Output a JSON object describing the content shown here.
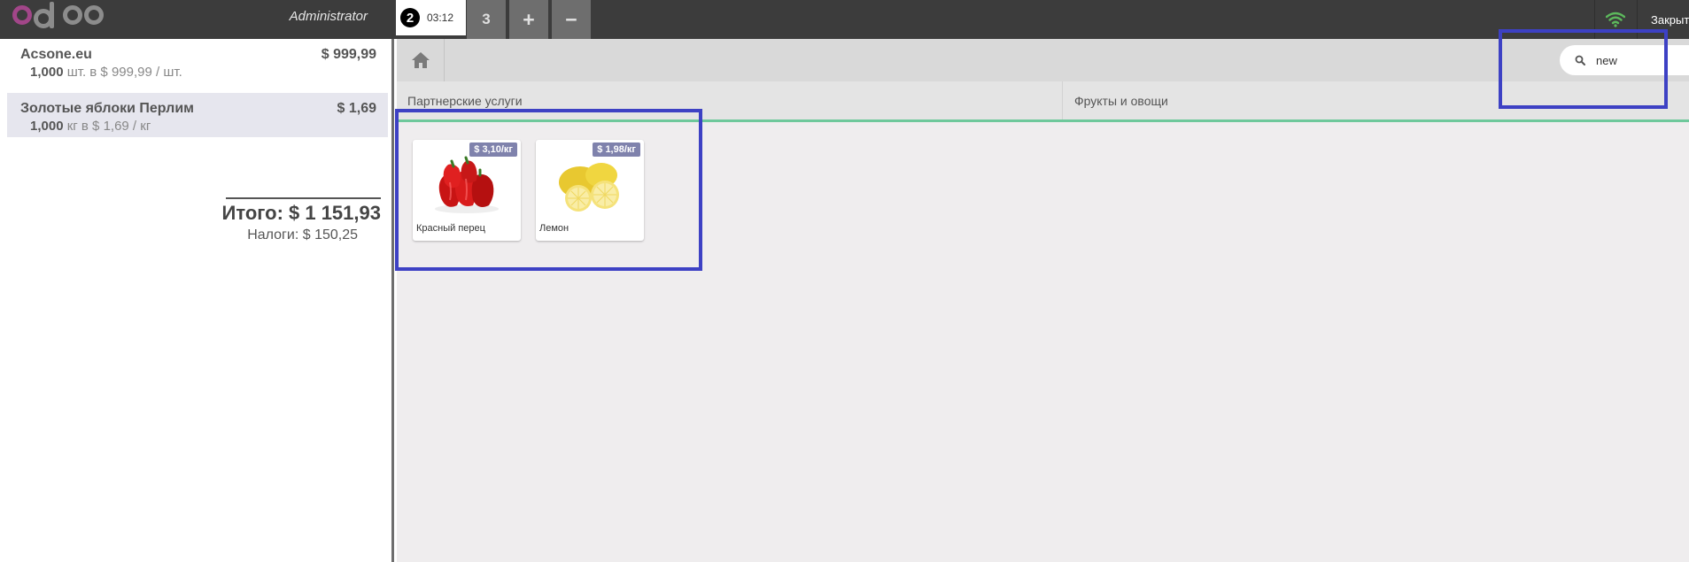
{
  "header": {
    "user": "Administrator",
    "active_order": {
      "number": "2",
      "time": "03:12"
    },
    "other_orders": [
      "3"
    ],
    "add_label": "+",
    "remove_label": "−",
    "close_label": "Закрыть",
    "wifi_color": "#5cb85c"
  },
  "order": {
    "lines": [
      {
        "name": "Acsone.eu",
        "price": "$ 999,99",
        "qty": "1,000",
        "info": "шт. в $ 999,99 / шт."
      },
      {
        "name": "Золотые яблоки Перлим",
        "price": "$ 1,69",
        "qty": "1,000",
        "info": "кг в $ 1,69 / кг"
      }
    ],
    "total": "Итого: $ 1 151,93",
    "taxes": "Налоги: $ 150,25"
  },
  "search": {
    "value": "new"
  },
  "categories": [
    "Партнерские услуги",
    "Фрукты и овощи"
  ],
  "products": [
    {
      "name": "Красный перец",
      "price": "$ 3,10/кг",
      "image": "red-pepper"
    },
    {
      "name": "Лемон",
      "price": "$ 1,98/кг",
      "image": "lemon"
    }
  ],
  "colors": {
    "highlight": "#3d41c4",
    "price_tag": "#7f82ac",
    "category_underline": "#6ec89b"
  }
}
